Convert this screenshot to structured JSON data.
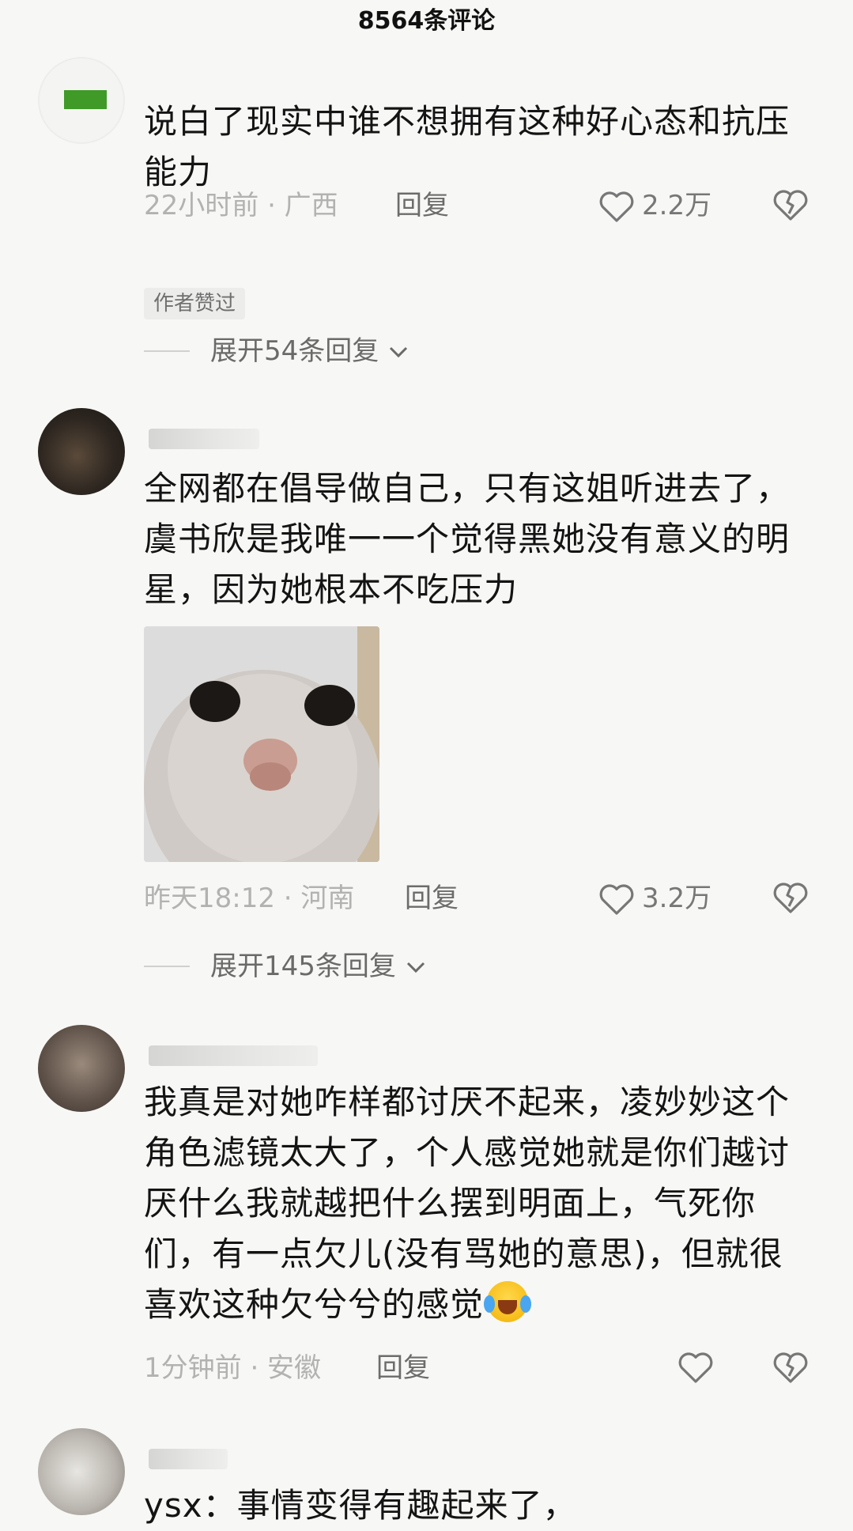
{
  "header": {
    "title": "8564条评论"
  },
  "comments": [
    {
      "text": "说白了现实中谁不想拥有这种好心态和抗压能力",
      "meta": "22小时前 · 广西",
      "reply_label": "回复",
      "likes": "2.2万",
      "badge": "作者赞过",
      "expand_label": "展开54条回复"
    },
    {
      "text": "全网都在倡导做自己，只有这姐听进去了，虞书欣是我唯一一个觉得黑她没有意义的明星，因为她根本不吃压力",
      "meta": "昨天18:12 · 河南",
      "reply_label": "回复",
      "likes": "3.2万",
      "expand_label": "展开145条回复"
    },
    {
      "text": "我真是对她咋样都讨厌不起来，凌妙妙这个角色滤镜太大了，个人感觉她就是你们越讨厌什么我就越把什么摆到明面上，气死你们，有一点欠儿(没有骂她的意思)，但就很喜欢这种欠兮兮的感觉",
      "meta": "1分钟前 · 安徽",
      "reply_label": "回复"
    },
    {
      "text": "ysx：事情变得有趣起来了，"
    }
  ],
  "colors": {
    "avatar_mark": "#3f9a28",
    "background": "#f7f7f5"
  }
}
